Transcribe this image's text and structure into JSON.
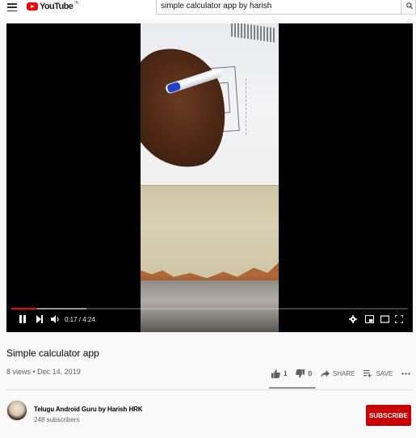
{
  "masthead": {
    "logo_text": "YouTube",
    "logo_region": "IN",
    "search_query": "simple calculator app by harish"
  },
  "player": {
    "time_display": "0:17 / 4:24",
    "played_fraction": 0.066,
    "buffered_fraction": 0.19,
    "state": "playing"
  },
  "video": {
    "title": "Simple calculator app",
    "views_date": "8 views • Dec 14, 2019",
    "like_count": "1",
    "dislike_count": "0",
    "share_label": "SHARE",
    "save_label": "SAVE"
  },
  "channel": {
    "name": "Telugu Android Guru by Harish HRK",
    "subscribers": "248 subscribers",
    "subscribe_label": "SUBSCRIBE"
  },
  "colors": {
    "brand_red": "#ff0000",
    "subscribe_red": "#cc0000"
  }
}
